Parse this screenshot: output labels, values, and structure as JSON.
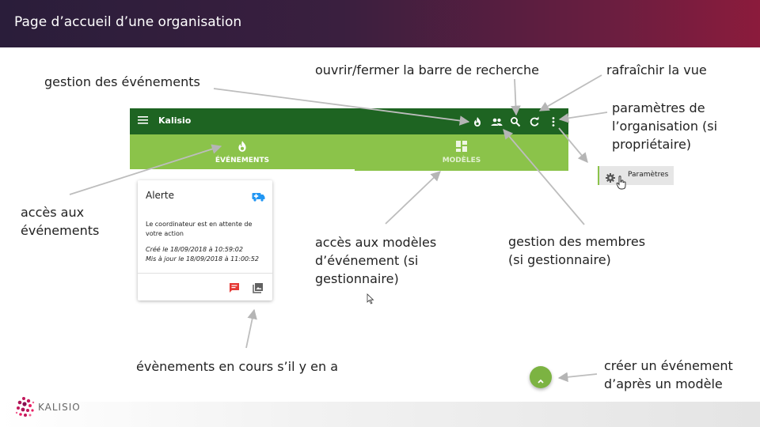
{
  "slide": {
    "title": "Page d’accueil d’une organisation"
  },
  "logo": {
    "name": "KALISIO"
  },
  "app": {
    "name": "Kalisio",
    "toolbar_icons": [
      "menu-icon",
      "fire-icon",
      "people-icon",
      "search-icon",
      "refresh-icon",
      "more-vert-icon"
    ],
    "tabs": [
      {
        "label": "ÉVÉNEMENTS",
        "icon": "fire-icon",
        "active": true
      },
      {
        "label": "MODÈLES",
        "icon": "dashboard-icon",
        "active": false
      }
    ]
  },
  "card": {
    "title": "Alerte",
    "icon": "ambulance-icon",
    "description": "Le coordinateur est en attente de votre action",
    "created": "Créé le 18/09/2018 à 10:59:02",
    "updated": "Mis à jour le 18/09/2018 à 11:00:52",
    "actions": [
      "chat-icon",
      "image-icon"
    ]
  },
  "menu": {
    "item": "Paramètres",
    "icon": "gear-icon"
  },
  "annotations": {
    "events_management": "gestion des événements",
    "search_toggle": "ouvrir/fermer la barre de recherche",
    "refresh": "rafraîchir la vue",
    "org_settings": [
      "paramètres de",
      "l’organisation (si",
      "propriétaire)"
    ],
    "events_access": [
      "accès aux",
      "événements"
    ],
    "templates_access": [
      "accès aux modèles",
      "d’événement (si",
      "gestionnaire)"
    ],
    "members_management": [
      "gestion des membres",
      "(si gestionnaire)"
    ],
    "ongoing_events": "évènements en cours s’il y en a",
    "create_event": [
      "créer un événement",
      "d’après un modèle"
    ]
  },
  "colors": {
    "toolbar": "#1e6422",
    "tabs": "#8bc34a",
    "fab": "#7cb342",
    "header_start": "#2a1d3a",
    "header_end": "#8b1b3c"
  }
}
